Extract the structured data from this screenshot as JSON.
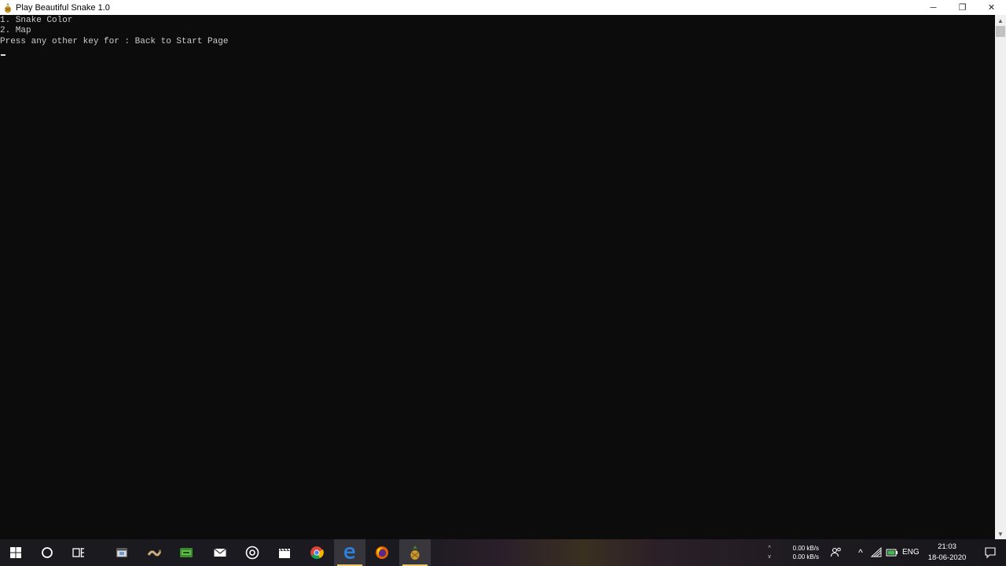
{
  "window": {
    "title": "Play Beautiful Snake 1.0",
    "controls": {
      "minimize": "─",
      "maximize": "❐",
      "close": "✕"
    }
  },
  "console": {
    "lines": [
      "1. Snake Color",
      "2. Map",
      "Press any other key for : Back to Start Page"
    ]
  },
  "scrollbar": {
    "up": "▲",
    "down": "▼"
  },
  "taskbar": {
    "apps": [
      {
        "name": "windows-start",
        "icon": "windows-logo-icon"
      },
      {
        "name": "cortana",
        "icon": "circle-icon"
      },
      {
        "name": "task-view",
        "icon": "task-view-icon"
      },
      {
        "name": "app-window",
        "icon": "window-app-icon"
      },
      {
        "name": "app-snake",
        "icon": "snake-icon"
      },
      {
        "name": "app-green",
        "icon": "green-app-icon"
      },
      {
        "name": "mail",
        "icon": "mail-icon"
      },
      {
        "name": "media",
        "icon": "disc-icon"
      },
      {
        "name": "video",
        "icon": "clapper-icon"
      },
      {
        "name": "chrome",
        "icon": "chrome-icon"
      },
      {
        "name": "edge",
        "icon": "edge-icon"
      },
      {
        "name": "firefox",
        "icon": "firefox-icon"
      },
      {
        "name": "snake-game",
        "icon": "pineapple-icon"
      }
    ],
    "net_up": "0.00 kB/s",
    "net_down": "0.00 kB/s",
    "net_up_arrow": "^",
    "net_down_arrow": "v",
    "tray_chevron": "^",
    "language": "ENG",
    "time": "21:03",
    "date": "18-06-2020"
  },
  "colors": {
    "console_bg": "#0c0c0c",
    "console_text": "#cccccc",
    "titlebar_bg": "#ffffff",
    "accent": "#e8c46a"
  }
}
